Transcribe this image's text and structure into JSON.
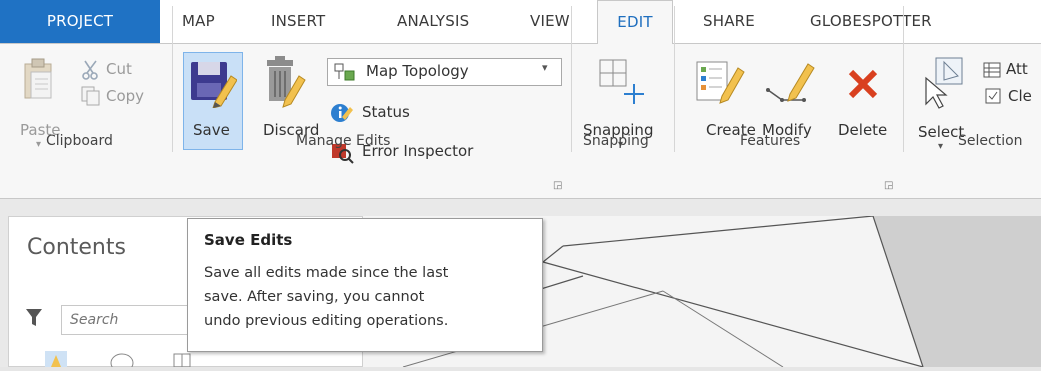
{
  "tabs": [
    {
      "label": "PROJECT"
    },
    {
      "label": "MAP"
    },
    {
      "label": "INSERT"
    },
    {
      "label": "ANALYSIS"
    },
    {
      "label": "VIEW"
    },
    {
      "label": "EDIT"
    },
    {
      "label": "SHARE"
    },
    {
      "label": "GLOBESPOTTER"
    }
  ],
  "clipboard": {
    "paste": "Paste",
    "cut": "Cut",
    "copy": "Copy",
    "group": "Clipboard"
  },
  "manage_edits": {
    "save": "Save",
    "discard": "Discard",
    "topology": "Map Topology",
    "status": "Status",
    "error_inspector": "Error Inspector",
    "group": "Manage Edits"
  },
  "snapping": {
    "label": "Snapping",
    "group": "Snapping"
  },
  "features": {
    "create": "Create",
    "modify": "Modify",
    "delete": "Delete",
    "group": "Features"
  },
  "selection": {
    "select": "Select",
    "attributes": "Att",
    "clear": "Cle",
    "group": "Selection"
  },
  "contents": {
    "title": "Contents",
    "search_placeholder": "Search"
  },
  "tooltip": {
    "title": "Save Edits",
    "line1": "Save all edits made since the last",
    "line2": "save.  After saving, you cannot",
    "line3": "undo previous editing operations."
  },
  "colors": {
    "accent": "#1f72c4",
    "highlight": "#c9e0f7",
    "delete": "#d9401f"
  }
}
